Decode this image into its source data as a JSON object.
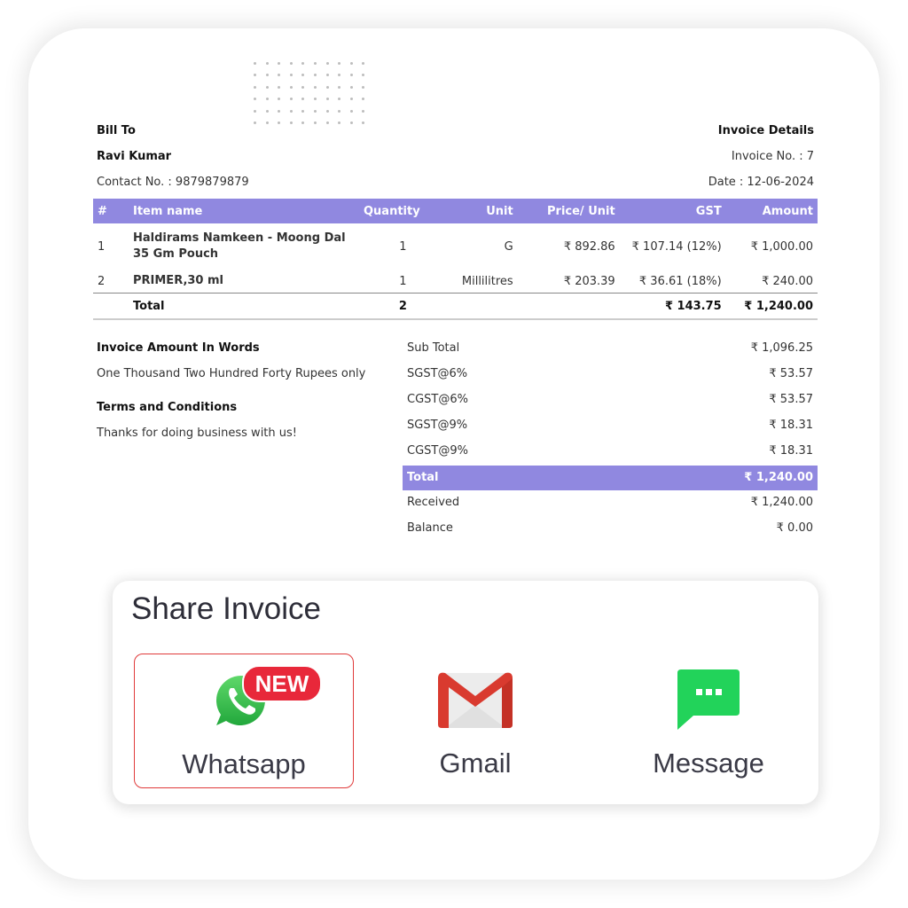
{
  "bill_to": {
    "heading": "Bill To",
    "name": "Ravi Kumar",
    "contact": "Contact No. : 9879879879"
  },
  "invoice_details": {
    "heading": "Invoice Details",
    "invoice_no": "Invoice No. : 7",
    "date": "Date : 12-06-2024"
  },
  "table": {
    "headers": [
      "#",
      "Item name",
      "Quantity",
      "Unit",
      "Price/ Unit",
      "GST",
      "Amount"
    ],
    "rows": [
      {
        "num": "1",
        "name": "Haldirams Namkeen - Moong Dal 35 Gm Pouch",
        "qty": "1",
        "unit": "G",
        "price": "₹ 892.86",
        "gst": "₹ 107.14 (12%)",
        "amount": "₹ 1,000.00"
      },
      {
        "num": "2",
        "name": "PRIMER,30 ml",
        "qty": "1",
        "unit": "Millilitres",
        "price": "₹ 203.39",
        "gst": "₹ 36.61 (18%)",
        "amount": "₹ 240.00"
      }
    ],
    "total": {
      "label": "Total",
      "qty": "2",
      "gst": "₹ 143.75",
      "amount": "₹ 1,240.00"
    }
  },
  "amount_in_words": {
    "heading": "Invoice Amount In Words",
    "text": "One Thousand Two Hundred Forty Rupees only"
  },
  "terms": {
    "heading": "Terms and Conditions",
    "text": "Thanks for doing business with us!"
  },
  "summary": [
    {
      "label": "Sub Total",
      "value": "₹ 1,096.25"
    },
    {
      "label": "SGST@6%",
      "value": "₹ 53.57"
    },
    {
      "label": "CGST@6%",
      "value": "₹ 53.57"
    },
    {
      "label": "SGST@9%",
      "value": "₹ 18.31"
    },
    {
      "label": "CGST@9%",
      "value": "₹ 18.31"
    },
    {
      "label": "Total",
      "value": "₹ 1,240.00"
    },
    {
      "label": "Received",
      "value": "₹ 1,240.00"
    },
    {
      "label": "Balance",
      "value": "₹ 0.00"
    }
  ],
  "share": {
    "title": "Share Invoice",
    "options": [
      {
        "label": "Whatsapp",
        "icon": "whatsapp-icon",
        "badge": "NEW",
        "selected": true
      },
      {
        "label": "Gmail",
        "icon": "gmail-icon"
      },
      {
        "label": "Message",
        "icon": "message-icon"
      }
    ]
  },
  "colors": {
    "accent": "#9088e0",
    "selected_border": "#e03a3a",
    "badge": "#e8283a",
    "whatsapp": "#2fb84a",
    "gmail": "#d93a2f",
    "message": "#22d35a"
  }
}
